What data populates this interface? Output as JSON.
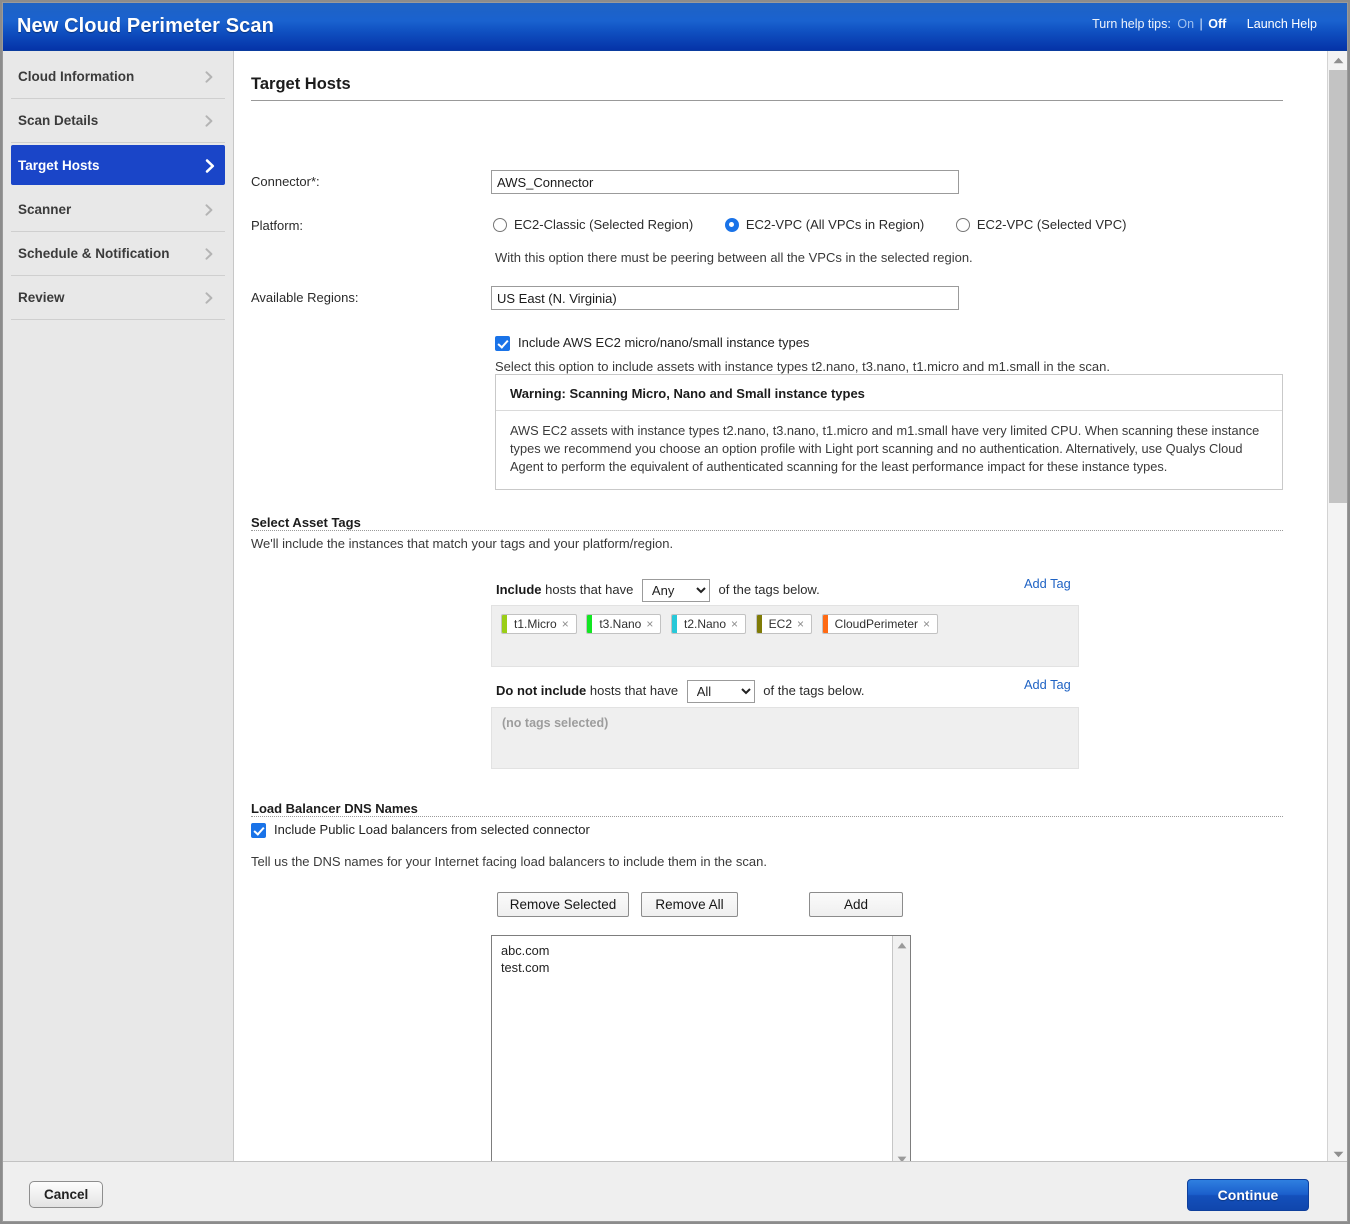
{
  "header": {
    "title": "New Cloud Perimeter Scan",
    "help_tips_label": "Turn help tips:",
    "help_on": "On",
    "help_sep": "|",
    "help_off": "Off",
    "launch_help": "Launch Help"
  },
  "sidebar": {
    "items": [
      {
        "label": "Cloud Information",
        "active": false
      },
      {
        "label": "Scan Details",
        "active": false
      },
      {
        "label": "Target Hosts",
        "active": true
      },
      {
        "label": "Scanner",
        "active": false
      },
      {
        "label": "Schedule & Notification",
        "active": false
      },
      {
        "label": "Review",
        "active": false
      }
    ]
  },
  "main": {
    "page_title": "Target Hosts",
    "connector": {
      "label": "Connector*:",
      "value": "AWS_Connector"
    },
    "platform": {
      "label": "Platform:",
      "options": [
        {
          "label": "EC2-Classic (Selected Region)",
          "selected": false
        },
        {
          "label": "EC2-VPC (All VPCs in Region)",
          "selected": true
        },
        {
          "label": "EC2-VPC (Selected VPC)",
          "selected": false
        }
      ],
      "note": "With this option there must be peering between all the VPCs in the selected region."
    },
    "regions": {
      "label": "Available Regions:",
      "value": "US East (N. Virginia)"
    },
    "micro_instances": {
      "checkbox_label": "Include AWS EC2 micro/nano/small instance types",
      "checked": true,
      "description": "Select this option to include assets with instance types t2.nano, t3.nano, t1.micro and m1.small in the scan.",
      "warning_title": "Warning: Scanning Micro, Nano and Small instance types",
      "warning_body": "AWS EC2 assets with instance types t2.nano, t3.nano, t1.micro and m1.small have very limited CPU. When scanning these instance types we recommend you choose an option profile with Light port scanning and no authentication. Alternatively, use Qualys Cloud Agent to perform the equivalent of authenticated scanning for the least performance impact for these instance types."
    },
    "asset_tags": {
      "section_title": "Select Asset Tags",
      "description": "We'll include the instances that match your tags and your platform/region.",
      "include": {
        "prefix_bold": "Include",
        "prefix_rest": " hosts that have ",
        "selected_option": "Any",
        "options": [
          "Any",
          "All"
        ],
        "suffix": " of the tags below.",
        "add_tag": "Add Tag",
        "tags": [
          {
            "name": "t1.Micro",
            "color": "#9ace17",
            "close": "×"
          },
          {
            "name": "t3.Nano",
            "color": "#12e622",
            "close": "×"
          },
          {
            "name": "t2.Nano",
            "color": "#28c8d8",
            "close": "×"
          },
          {
            "name": "EC2",
            "color": "#7f7b06",
            "close": "×"
          },
          {
            "name": "CloudPerimeter",
            "color": "#ff6a13",
            "close": "×"
          }
        ]
      },
      "exclude": {
        "prefix_bold": "Do not include",
        "prefix_rest": " hosts that have ",
        "selected_option": "All",
        "options": [
          "Any",
          "All"
        ],
        "suffix": " of the tags below.",
        "add_tag": "Add Tag",
        "empty_text": "(no tags selected)"
      }
    },
    "load_balancer": {
      "section_title": "Load Balancer DNS Names",
      "checkbox_label": "Include Public Load balancers from selected connector",
      "checked": true,
      "description": "Tell us the DNS names for your Internet facing load balancers to include them in the scan.",
      "buttons": {
        "remove_selected": "Remove Selected",
        "remove_all": "Remove All",
        "add": "Add"
      },
      "dns_names": [
        "abc.com",
        "test.com"
      ]
    }
  },
  "footer": {
    "cancel": "Cancel",
    "continue": "Continue"
  },
  "icons": {
    "chevron_right": "chevron-right-icon",
    "scroll_up": "scroll-up-arrow-icon",
    "scroll_down": "scroll-down-arrow-icon"
  }
}
